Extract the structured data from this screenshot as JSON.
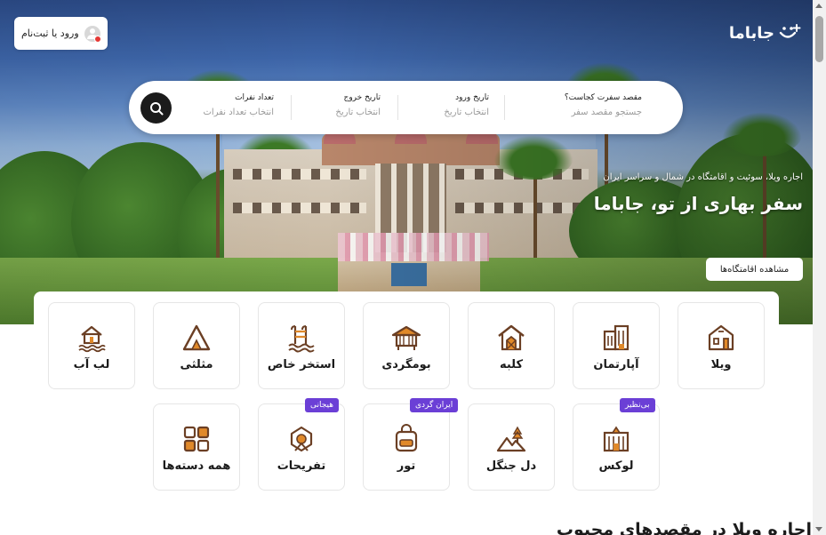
{
  "header": {
    "login_label": "ورود یا ثبت‌نام",
    "logo_text": "جاباما"
  },
  "search": {
    "destination": {
      "title": "مقصد سفرت کجاست؟",
      "placeholder": "جستجو مقصد سفر"
    },
    "checkin": {
      "title": "تاریخ ورود",
      "placeholder": "انتخاب تاریخ"
    },
    "checkout": {
      "title": "تاریخ خروج",
      "placeholder": "انتخاب تاریخ"
    },
    "guests": {
      "title": "تعداد نفرات",
      "placeholder": "انتخاب تعداد نفرات"
    }
  },
  "hero": {
    "subtitle": "اجاره ویلا، سوئیت و اقامتگاه در شمال و سراسر ایران",
    "title": "سفر بهاری از تو، جاباما",
    "cta": "مشاهده اقامتگاه‌ها"
  },
  "categories": [
    {
      "label": "ویلا",
      "icon": "villa-icon",
      "badge": ""
    },
    {
      "label": "آپارتمان",
      "icon": "apartment-icon",
      "badge": ""
    },
    {
      "label": "کلبه",
      "icon": "cabin-icon",
      "badge": ""
    },
    {
      "label": "بومگردی",
      "icon": "ecolodge-icon",
      "badge": ""
    },
    {
      "label": "استخر خاص",
      "icon": "pool-icon",
      "badge": ""
    },
    {
      "label": "مثلثی",
      "icon": "a-frame-icon",
      "badge": ""
    },
    {
      "label": "لب آب",
      "icon": "waterfront-icon",
      "badge": ""
    },
    {
      "label": "لوکس",
      "icon": "luxury-icon",
      "badge": "بی‌نظیر"
    },
    {
      "label": "دل جنگل",
      "icon": "forest-icon",
      "badge": ""
    },
    {
      "label": "تور",
      "icon": "tour-icon",
      "badge": "ایران گردی"
    },
    {
      "label": "تفریحات",
      "icon": "fun-icon",
      "badge": "هیجانی"
    },
    {
      "label": "همه دسته‌ها",
      "icon": "all-categories-icon",
      "badge": ""
    }
  ],
  "section": {
    "title": "اجاره ویلا در مقصدهای محبوب"
  },
  "colors": {
    "accent": "#6b3fd6",
    "dark": "#1b1b1b",
    "icon_brown": "#6b3f24",
    "icon_orange": "#e0892a"
  }
}
